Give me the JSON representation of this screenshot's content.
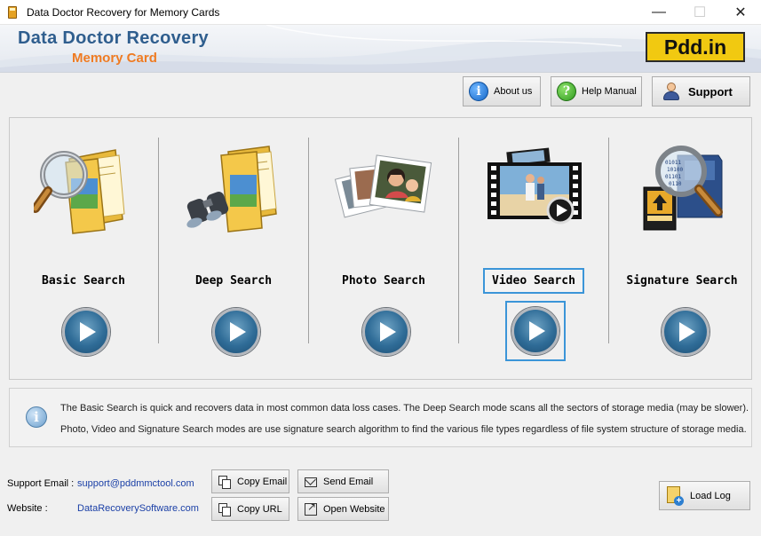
{
  "window": {
    "title": "Data Doctor Recovery for Memory Cards",
    "controls": {
      "minimize": "—",
      "maximize": "☐",
      "close": "✕"
    }
  },
  "banner": {
    "title": "Data Doctor Recovery",
    "subtitle": "Memory Card",
    "logo_text": "Pdd.in"
  },
  "toolbar": {
    "about": {
      "label": "About us",
      "icon": "info-icon"
    },
    "help": {
      "label": "Help Manual",
      "icon": "help-icon"
    },
    "support": {
      "label": "Support",
      "icon": "user-icon"
    }
  },
  "search_modes": [
    {
      "label": "Basic Search",
      "icon": "magnifier-folder-icon"
    },
    {
      "label": "Deep Search",
      "icon": "binoculars-folder-icon"
    },
    {
      "label": "Photo Search",
      "icon": "photos-icon"
    },
    {
      "label": "Video Search",
      "icon": "film-strip-icon",
      "focused": true
    },
    {
      "label": "Signature Search",
      "icon": "memory-card-magnifier-icon"
    }
  ],
  "info": {
    "line1": "The Basic Search is quick and recovers data in most common data loss cases. The Deep Search mode scans all the sectors of storage media (may be slower).",
    "line2": "Photo, Video and Signature Search modes are use signature search algorithm to find the various file types regardless of file system structure of storage media."
  },
  "footer": {
    "support_email_label": "Support Email :",
    "support_email": "support@pddmmctool.com",
    "website_label": "Website :",
    "website": "DataRecoverySoftware.com",
    "copy_email": "Copy Email",
    "send_email": "Send Email",
    "copy_url": "Copy URL",
    "open_website": "Open Website",
    "load_log": "Load Log"
  },
  "colors": {
    "brand_blue": "#2f5e8e",
    "brand_orange": "#ef7b22",
    "logo_yellow": "#f1c911",
    "focus_blue": "#3b95d8",
    "link_blue": "#1a3fa6"
  }
}
